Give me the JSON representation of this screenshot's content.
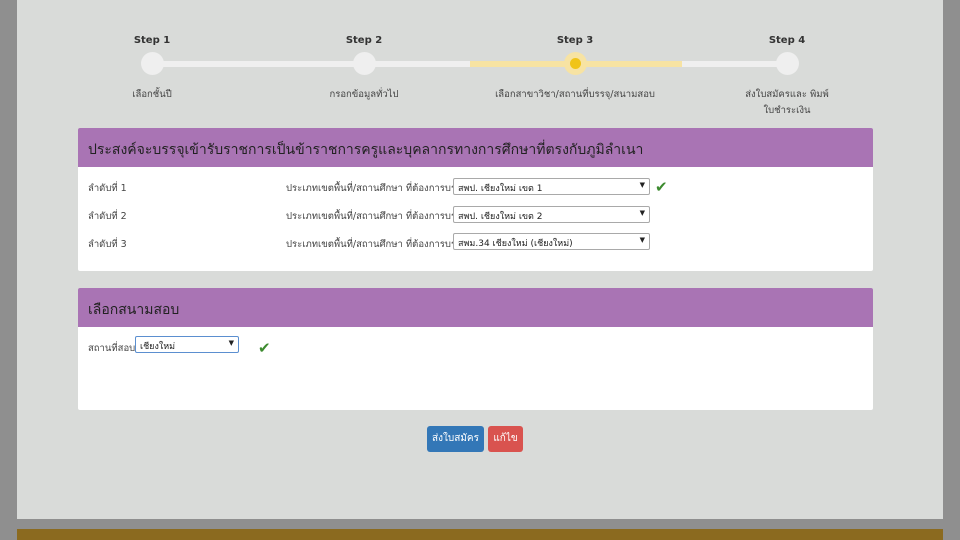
{
  "stepper": {
    "steps": [
      {
        "title": "Step 1",
        "label": "เลือกชั้นปี"
      },
      {
        "title": "Step 2",
        "label": "กรอกข้อมูลทั่วไป"
      },
      {
        "title": "Step 3",
        "label": "เลือกสาขาวิชา/สถานที่บรรจุ/สนามสอบ"
      },
      {
        "title": "Step 4",
        "label": "ส่งใบสมัครและ พิมพ์ใบชำระเงิน"
      }
    ],
    "active_step": 3,
    "colors": {
      "track": "#efefef",
      "track_active": "#f7e3a3",
      "dot_active": "#f0c419"
    }
  },
  "placement_panel": {
    "title": "ประสงค์จะบรรจุเข้ารับราชการเป็นข้าราชการครูและบุคลากรทางการศึกษาที่ตรงกับภูมิลำเนา",
    "rows": [
      {
        "label": "ลำดับที่ 1",
        "desc": "ประเภทเขตพื้นที่/สถานศึกษา ที่ต้องการบรรจุ",
        "value": "สพป. เชียงใหม่ เขต 1",
        "checked": true
      },
      {
        "label": "ลำดับที่ 2",
        "desc": "ประเภทเขตพื้นที่/สถานศึกษา ที่ต้องการบรรจุ",
        "value": "สพป. เชียงใหม่ เขต 2",
        "checked": false
      },
      {
        "label": "ลำดับที่ 3",
        "desc": "ประเภทเขตพื้นที่/สถานศึกษา ที่ต้องการบรรจุ",
        "value": "สพม.34 เชียงใหม่ (เชียงใหม่)",
        "checked": false
      }
    ]
  },
  "exam_panel": {
    "title": "เลือกสนามสอบ",
    "field_label": "สถานที่สอบ",
    "value": "เชียงใหม่",
    "checked": true
  },
  "buttons": {
    "submit": "ส่งใบสมัคร",
    "edit": "แก้ไข"
  },
  "colors": {
    "panel_header": "#a974b4",
    "primary": "#3377b7",
    "danger": "#d9534f",
    "check": "#3d8b2f",
    "footer": "#8b6a1f"
  }
}
